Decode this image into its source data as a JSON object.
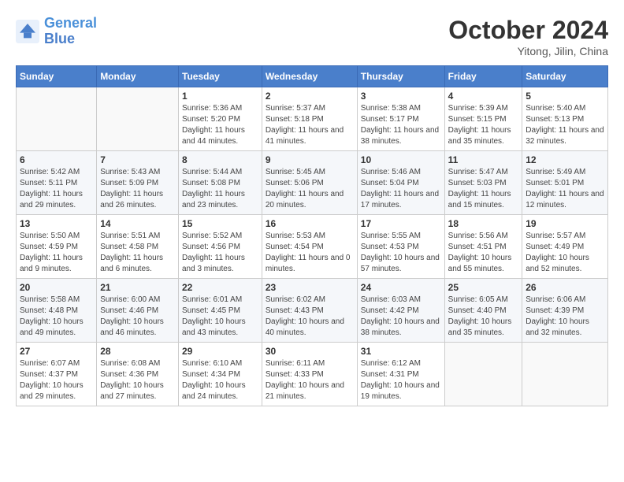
{
  "header": {
    "logo_line1": "General",
    "logo_line2": "Blue",
    "month": "October 2024",
    "location": "Yitong, Jilin, China"
  },
  "weekdays": [
    "Sunday",
    "Monday",
    "Tuesday",
    "Wednesday",
    "Thursday",
    "Friday",
    "Saturday"
  ],
  "weeks": [
    [
      {
        "day": "",
        "info": ""
      },
      {
        "day": "",
        "info": ""
      },
      {
        "day": "1",
        "info": "Sunrise: 5:36 AM\nSunset: 5:20 PM\nDaylight: 11 hours and 44 minutes."
      },
      {
        "day": "2",
        "info": "Sunrise: 5:37 AM\nSunset: 5:18 PM\nDaylight: 11 hours and 41 minutes."
      },
      {
        "day": "3",
        "info": "Sunrise: 5:38 AM\nSunset: 5:17 PM\nDaylight: 11 hours and 38 minutes."
      },
      {
        "day": "4",
        "info": "Sunrise: 5:39 AM\nSunset: 5:15 PM\nDaylight: 11 hours and 35 minutes."
      },
      {
        "day": "5",
        "info": "Sunrise: 5:40 AM\nSunset: 5:13 PM\nDaylight: 11 hours and 32 minutes."
      }
    ],
    [
      {
        "day": "6",
        "info": "Sunrise: 5:42 AM\nSunset: 5:11 PM\nDaylight: 11 hours and 29 minutes."
      },
      {
        "day": "7",
        "info": "Sunrise: 5:43 AM\nSunset: 5:09 PM\nDaylight: 11 hours and 26 minutes."
      },
      {
        "day": "8",
        "info": "Sunrise: 5:44 AM\nSunset: 5:08 PM\nDaylight: 11 hours and 23 minutes."
      },
      {
        "day": "9",
        "info": "Sunrise: 5:45 AM\nSunset: 5:06 PM\nDaylight: 11 hours and 20 minutes."
      },
      {
        "day": "10",
        "info": "Sunrise: 5:46 AM\nSunset: 5:04 PM\nDaylight: 11 hours and 17 minutes."
      },
      {
        "day": "11",
        "info": "Sunrise: 5:47 AM\nSunset: 5:03 PM\nDaylight: 11 hours and 15 minutes."
      },
      {
        "day": "12",
        "info": "Sunrise: 5:49 AM\nSunset: 5:01 PM\nDaylight: 11 hours and 12 minutes."
      }
    ],
    [
      {
        "day": "13",
        "info": "Sunrise: 5:50 AM\nSunset: 4:59 PM\nDaylight: 11 hours and 9 minutes."
      },
      {
        "day": "14",
        "info": "Sunrise: 5:51 AM\nSunset: 4:58 PM\nDaylight: 11 hours and 6 minutes."
      },
      {
        "day": "15",
        "info": "Sunrise: 5:52 AM\nSunset: 4:56 PM\nDaylight: 11 hours and 3 minutes."
      },
      {
        "day": "16",
        "info": "Sunrise: 5:53 AM\nSunset: 4:54 PM\nDaylight: 11 hours and 0 minutes."
      },
      {
        "day": "17",
        "info": "Sunrise: 5:55 AM\nSunset: 4:53 PM\nDaylight: 10 hours and 57 minutes."
      },
      {
        "day": "18",
        "info": "Sunrise: 5:56 AM\nSunset: 4:51 PM\nDaylight: 10 hours and 55 minutes."
      },
      {
        "day": "19",
        "info": "Sunrise: 5:57 AM\nSunset: 4:49 PM\nDaylight: 10 hours and 52 minutes."
      }
    ],
    [
      {
        "day": "20",
        "info": "Sunrise: 5:58 AM\nSunset: 4:48 PM\nDaylight: 10 hours and 49 minutes."
      },
      {
        "day": "21",
        "info": "Sunrise: 6:00 AM\nSunset: 4:46 PM\nDaylight: 10 hours and 46 minutes."
      },
      {
        "day": "22",
        "info": "Sunrise: 6:01 AM\nSunset: 4:45 PM\nDaylight: 10 hours and 43 minutes."
      },
      {
        "day": "23",
        "info": "Sunrise: 6:02 AM\nSunset: 4:43 PM\nDaylight: 10 hours and 40 minutes."
      },
      {
        "day": "24",
        "info": "Sunrise: 6:03 AM\nSunset: 4:42 PM\nDaylight: 10 hours and 38 minutes."
      },
      {
        "day": "25",
        "info": "Sunrise: 6:05 AM\nSunset: 4:40 PM\nDaylight: 10 hours and 35 minutes."
      },
      {
        "day": "26",
        "info": "Sunrise: 6:06 AM\nSunset: 4:39 PM\nDaylight: 10 hours and 32 minutes."
      }
    ],
    [
      {
        "day": "27",
        "info": "Sunrise: 6:07 AM\nSunset: 4:37 PM\nDaylight: 10 hours and 29 minutes."
      },
      {
        "day": "28",
        "info": "Sunrise: 6:08 AM\nSunset: 4:36 PM\nDaylight: 10 hours and 27 minutes."
      },
      {
        "day": "29",
        "info": "Sunrise: 6:10 AM\nSunset: 4:34 PM\nDaylight: 10 hours and 24 minutes."
      },
      {
        "day": "30",
        "info": "Sunrise: 6:11 AM\nSunset: 4:33 PM\nDaylight: 10 hours and 21 minutes."
      },
      {
        "day": "31",
        "info": "Sunrise: 6:12 AM\nSunset: 4:31 PM\nDaylight: 10 hours and 19 minutes."
      },
      {
        "day": "",
        "info": ""
      },
      {
        "day": "",
        "info": ""
      }
    ]
  ]
}
